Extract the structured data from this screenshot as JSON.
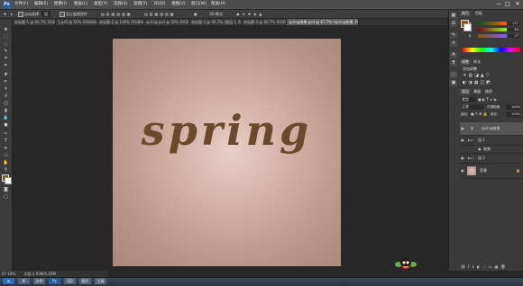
{
  "menubar": {
    "logo": "Ps",
    "items": [
      "文件(F)",
      "编辑(E)",
      "图像(I)",
      "图层(L)",
      "类型(Y)",
      "选择(S)",
      "滤镜(T)",
      "3D(D)",
      "视图(V)",
      "窗口(W)",
      "帮助(H)"
    ],
    "window_controls": [
      "—",
      "□",
      "✕"
    ]
  },
  "options": {
    "tool_preset": "▸",
    "auto_select_label": "自动选择:",
    "auto_select_value": "组",
    "transform_label": "显示变换控件",
    "mode_3d": "3D 模式:"
  },
  "tabs": [
    "未标题-1 @ 66.7% (RGB/8)",
    "1.psd @ 50% (RGB/8)",
    "未标题-2 @ 100% (RGB/8)",
    "spring.psd @ 50% (RGB/8#)",
    "未标题-3 @ 66.7% (图层 1, RGB/8)",
    "未标题-4 @ 66.7% (RGB/8)",
    "spring效果.psd @ 67.7% (spring效果, RGB/8)"
  ],
  "canvas": {
    "text": "spring"
  },
  "status": {
    "zoom": "67.18%",
    "doc": "文档:1.03M/5.45M"
  },
  "color_panel": {
    "tabs": [
      "颜色",
      "色板"
    ],
    "r_label": "R",
    "r_value": "137",
    "g_label": "G",
    "g_value": "89",
    "b_label": "B",
    "b_value": "27"
  },
  "adjust_panel": {
    "tabs": [
      "调整",
      "样式"
    ],
    "title": "添加调整"
  },
  "layers_panel": {
    "tabs": [
      "图层",
      "通道",
      "路径"
    ],
    "kind_label": "类型",
    "blend_mode": "正常",
    "opacity_label": "不透明度:",
    "opacity_value": "100%",
    "lock_label": "锁定:",
    "fill_label": "填充:",
    "fill_value": "100%",
    "layers": [
      {
        "name": "spring效果",
        "type": "text"
      },
      {
        "name": "组 1",
        "type": "group"
      },
      {
        "name": "效果",
        "type": "fx"
      },
      {
        "name": "组 2",
        "type": "group"
      },
      {
        "name": "背景",
        "type": "image"
      }
    ]
  },
  "taskbar": {
    "items": [
      "IE",
      "文件",
      "Ps",
      "QQ",
      "图片",
      "工具"
    ]
  },
  "colors": {
    "spring_text": "#6b4a2c",
    "canvas_center": "#e8cfc4",
    "canvas_edge": "#a88679",
    "foreground": "#89591b"
  }
}
